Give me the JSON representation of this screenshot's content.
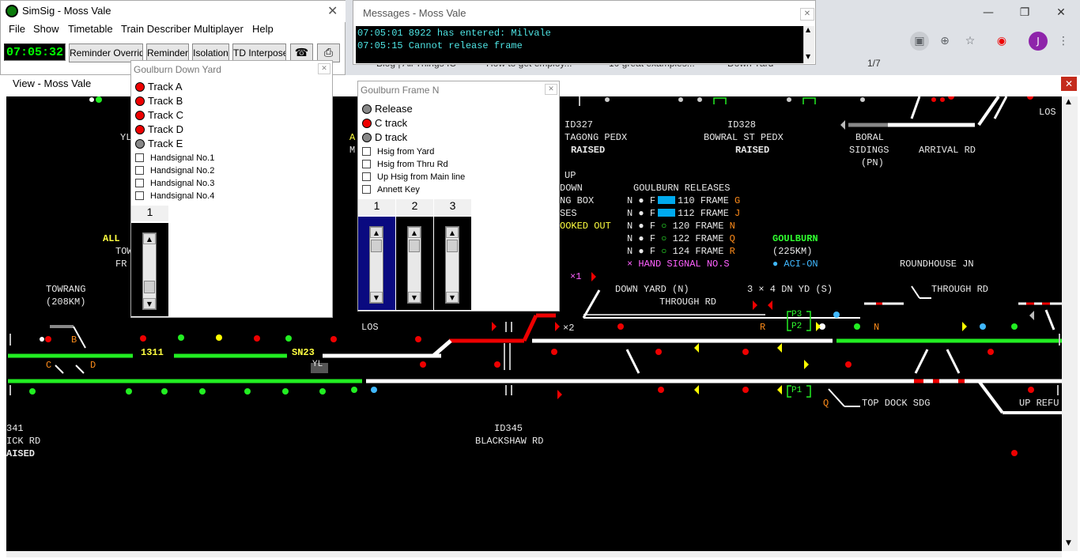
{
  "browser": {
    "tabs": [
      {
        "label": "Blog | All Things IC"
      },
      {
        "label": "How to get employ..."
      },
      {
        "label": "10 great examples..."
      },
      {
        "label": "Down Yard"
      }
    ],
    "page_count": "1/7",
    "profile_initial": "J"
  },
  "simsig": {
    "title": "SimSig - Moss Vale",
    "menu": [
      "File",
      "Show",
      "Timetable",
      "Train Describer",
      "Multiplayer",
      "Help"
    ],
    "clock": "07:05:32",
    "toolbar": [
      "Reminder Override",
      "Reminder",
      "Isolation",
      "TD Interpose"
    ]
  },
  "messages": {
    "title": "Messages - Moss Vale",
    "lines": [
      "07:05:01 8922 has entered: Milvale",
      "07:05:15 Cannot release frame"
    ]
  },
  "view": {
    "title": "View - Moss Vale"
  },
  "goulburn_down_yard": {
    "title": "Goulburn Down Yard",
    "tracks": [
      {
        "label": "Track A",
        "state": "red"
      },
      {
        "label": "Track B",
        "state": "red"
      },
      {
        "label": "Track C",
        "state": "red"
      },
      {
        "label": "Track D",
        "state": "red"
      },
      {
        "label": "Track E",
        "state": "grey"
      }
    ],
    "handsignals": [
      "Handsignal No.1",
      "Handsignal No.2",
      "Handsignal No.3",
      "Handsignal No.4"
    ],
    "lever": "1"
  },
  "goulburn_frame_n": {
    "title": "Goulburn Frame N",
    "states": [
      {
        "label": "Release",
        "state": "grey"
      },
      {
        "label": "C track",
        "state": "red"
      },
      {
        "label": "D track",
        "state": "grey"
      }
    ],
    "checkboxes": [
      "Hsig from Yard",
      "Hsig from Thru Rd",
      "Up Hsig from Main line",
      "Annett Key"
    ],
    "levers": [
      "1",
      "2",
      "3"
    ]
  },
  "panel": {
    "labels": {
      "id327": "ID327",
      "tagong": "TAGONG PEDX",
      "raised1": "RAISED",
      "id328": "ID328",
      "bowral": "BOWRAL ST PEDX",
      "raised2": "RAISED",
      "boral": "BORAL",
      "sidings": "SIDINGS",
      "pn": "(PN)",
      "arrival": "ARRIVAL RD",
      "los_top": "LOS",
      "up": "UP",
      "down": "DOWN",
      "box": "NG BOX",
      "ses": "SES",
      "booked_out": "OOKED OUT",
      "releases_title": "GOULBURN RELEASES",
      "hand_signal": "HAND SIGNAL NO.S",
      "goulburn": "GOULBURN",
      "km225": "(225KM)",
      "aci": "ACI-ON",
      "roundhouse": "ROUNDHOUSE JN",
      "down_yard": "DOWN YARD (N)",
      "through_rd": "THROUGH RD",
      "dn_yd": "3 × 4 DN YD (S)",
      "through_rd2": "THROUGH RD",
      "towrang": "TOWRANG",
      "km208": "(208KM)",
      "all": "ALL",
      "tow": "TOW",
      "fr": "FR",
      "yl_top": "YL",
      "a_top": "A",
      "m_top": "M",
      "los_mid": "LOS",
      "id341": "341",
      "ick_rd": "ICK RD",
      "aised": "AISED",
      "id345": "ID345",
      "blackshaw": "BLACKSHAW RD",
      "top_dock": "TOP DOCK SDG",
      "up_refu": "UP REFU",
      "berth_1311": "1311",
      "berth_sn23": "SN23",
      "yl_tag": "YL",
      "x1": "×1",
      "x2": "×2",
      "p3": "P3",
      "p2": "P2",
      "p1": "P1",
      "b": "B",
      "c": "C",
      "d": "D",
      "n_lbl": "N",
      "r_lbl": "R",
      "q_lbl": "Q"
    },
    "releases": [
      {
        "left": "N",
        "mid": "F",
        "frame": "110 FRAME",
        "letter": "G"
      },
      {
        "left": "N",
        "mid": "F",
        "frame": "112 FRAME",
        "letter": "J"
      },
      {
        "left": "N",
        "mid": "F",
        "frame": "120 FRAME",
        "letter": "N"
      },
      {
        "left": "N",
        "mid": "F",
        "frame": "122 FRAME",
        "letter": "Q"
      },
      {
        "left": "N",
        "mid": "F",
        "frame": "124 FRAME",
        "letter": "R"
      }
    ],
    "colors": {
      "track_clear": "#ffffff",
      "track_occupied": "#ee0000",
      "track_set": "#22ee22",
      "panel_bg": "#000000"
    }
  }
}
